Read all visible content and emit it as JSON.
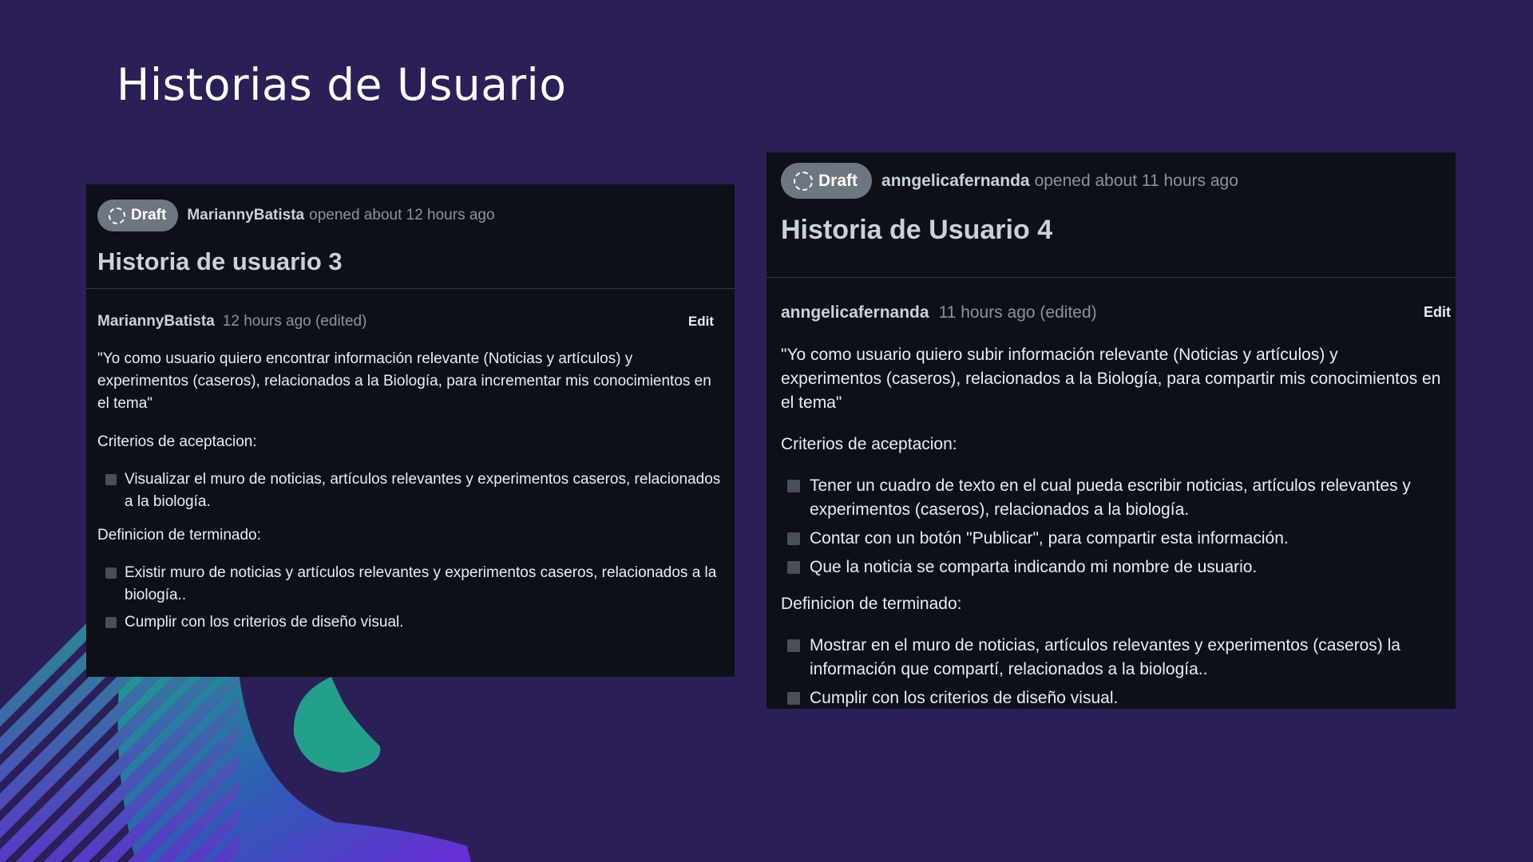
{
  "slide": {
    "title": "Historias de Usuario",
    "background_color": "#2c1f57",
    "card_color": "#0d1117"
  },
  "cards": [
    {
      "draft_label": "Draft",
      "author": "MariannyBatista",
      "opened_text": "opened about 12 hours ago",
      "title": "Historia de usuario 3",
      "comment": {
        "author": "MariannyBatista",
        "time": "12 hours ago (edited)",
        "edit_label": "Edit",
        "quote": "\"Yo como usuario quiero encontrar información relevante (Noticias y artículos) y experimentos (caseros), relacionados a la Biología, para incrementar mis conocimientos en el tema\"",
        "criteria_heading": "Criterios de aceptacion:",
        "criteria": [
          "Visualizar el muro de noticias, artículos relevantes y experimentos caseros, relacionados a la biología."
        ],
        "done_heading": "Definicion de terminado:",
        "done": [
          "Existir muro de noticias y artículos relevantes y experimentos caseros, relacionados a la biología..",
          "Cumplir con los criterios de diseño visual."
        ]
      }
    },
    {
      "draft_label": "Draft",
      "author": "anngelicafernanda",
      "opened_text": "opened about 11 hours ago",
      "title": "Historia de Usuario 4",
      "comment": {
        "author": "anngelicafernanda",
        "time": "11 hours ago (edited)",
        "edit_label": "Edit",
        "quote": "\"Yo como usuario quiero subir información relevante (Noticias y artículos) y experimentos (caseros), relacionados a la Biología, para compartir mis conocimientos en el tema\"",
        "criteria_heading": "Criterios de aceptacion:",
        "criteria": [
          "Tener un cuadro de texto en el cual pueda escribir noticias, artículos relevantes y experimentos (caseros), relacionados a la biología.",
          "Contar con un botón \"Publicar\", para compartir esta información.",
          "Que la noticia se comparta indicando mi nombre de usuario."
        ],
        "done_heading": "Definicion de terminado:",
        "done": [
          "Mostrar en el muro de noticias, artículos relevantes y experimentos (caseros) la información que compartí, relacionados a la biología..",
          "Cumplir con los criterios de diseño visual."
        ]
      }
    }
  ]
}
